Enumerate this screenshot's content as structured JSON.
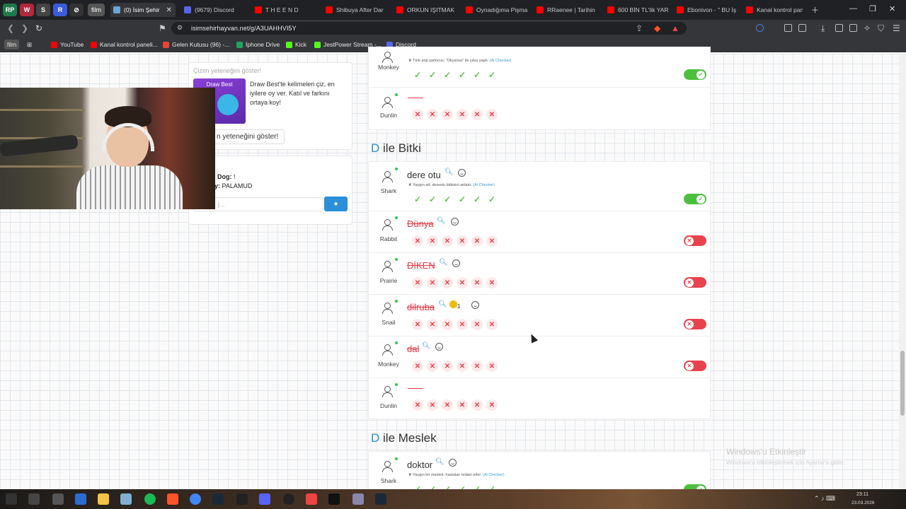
{
  "browser": {
    "pinned": [
      "RP",
      "W",
      "S",
      "R",
      "⊘",
      "film"
    ],
    "tabs": [
      {
        "title": "(0) İsim Şehir",
        "active": true,
        "color": "#6aa6d8"
      },
      {
        "title": "(9679) Discord",
        "color": "#5865f2"
      },
      {
        "title": "T H E   E N D",
        "color": "#ff0000"
      },
      {
        "title": "Shibuya After Dar",
        "color": "#ff0000"
      },
      {
        "title": "ORKUN IŞITMAK",
        "color": "#ff0000"
      },
      {
        "title": "Oynadığıma Pişma",
        "color": "#ff0000"
      },
      {
        "title": "RRaenee | Tarihin",
        "color": "#ff0000"
      },
      {
        "title": "600 BİN TL'lik YAR",
        "color": "#ff0000"
      },
      {
        "title": "Ebonivon - \" BU İş",
        "color": "#ff0000"
      },
      {
        "title": "Kanal kontrol pan",
        "color": "#ff0000"
      }
    ],
    "url": "isimsehirhayvan.net/g/A3UAHHVI5Y",
    "bookmarks": [
      {
        "label": "film",
        "color": "#888"
      },
      {
        "label": "YouTube",
        "color": "#ff0000"
      },
      {
        "label": "Kanal kontrol paneli...",
        "color": "#ff0000"
      },
      {
        "label": "Gelen Kutusu (96) -...",
        "color": "#ea4335"
      },
      {
        "label": "İphone Drive",
        "color": "#1fa463"
      },
      {
        "label": "Kick",
        "color": "#53fc18"
      },
      {
        "label": "JestPower Stream -...",
        "color": "#53fc18"
      },
      {
        "label": "Discord",
        "color": "#5865f2"
      }
    ]
  },
  "promo": {
    "header": "Çizim yeteneğini göster!",
    "img_caption": "Draw Best",
    "text": "Draw Best'te kelimeleri çiz, en iyilere oy ver. Katıl ve farkını ortaya koy!",
    "button": "n yeteneğini göster!"
  },
  "chat": {
    "line1_label": "Dog:",
    "line1_value": "!",
    "line2_label": "y:",
    "line2_value": "PALAMUD",
    "input_placeholder": "j..."
  },
  "prev_section": {
    "rows": [
      {
        "player": "Monkey",
        "hint": "Türk pop şarkıcısı; \"Okyanus\" ile çıkış yaptı.",
        "ai": "(Ai Checker)",
        "ok": 6,
        "no": 0,
        "toggle": "on"
      },
      {
        "player": "Dunlin",
        "word": "",
        "ok": 0,
        "no": 6
      }
    ]
  },
  "sections": [
    {
      "letter": "D",
      "title": "ile Bitki",
      "rows": [
        {
          "player": "Shark",
          "word": "dere otu",
          "hint": "Yaygın ad; dereotu bitkisini anlatır.",
          "ai": "(Ai Checker)",
          "ok": 6,
          "no": 0,
          "toggle": "on"
        },
        {
          "player": "Rabbit",
          "word": "Dünya",
          "bad": true,
          "ok": 0,
          "no": 6,
          "toggle": "off"
        },
        {
          "player": "Prairie",
          "word": "DİKEN",
          "bad": true,
          "ok": 0,
          "no": 6,
          "toggle": "off"
        },
        {
          "player": "Snail",
          "word": "dilruba",
          "bad": true,
          "reaction": "😮",
          "reaction_count": "1",
          "ok": 0,
          "no": 6,
          "toggle": "off"
        },
        {
          "player": "Monkey",
          "word": "dal",
          "bad": true,
          "ok": 0,
          "no": 6,
          "toggle": "off"
        },
        {
          "player": "Dunlin",
          "word": "",
          "ok": 0,
          "no": 6
        }
      ]
    },
    {
      "letter": "D",
      "title": "ile Meslek",
      "rows": [
        {
          "player": "Shark",
          "word": "doktor",
          "hint": "Yaygın bir meslek; hastaları tedavi eder.",
          "ai": "(Ai Checker)",
          "ok": 6,
          "no": 0,
          "toggle": "on"
        }
      ]
    }
  ],
  "watermark": {
    "line1": "Windows'u Etkinleştir",
    "line2": "Windows'u etkinleştirmek için Ayarlar'a gidin."
  },
  "clock": {
    "time": "23:11",
    "date": "23.03.2026"
  },
  "colors": {
    "accent": "#2a8fd8",
    "ok": "#5ec24a",
    "bad": "#e8434d"
  }
}
